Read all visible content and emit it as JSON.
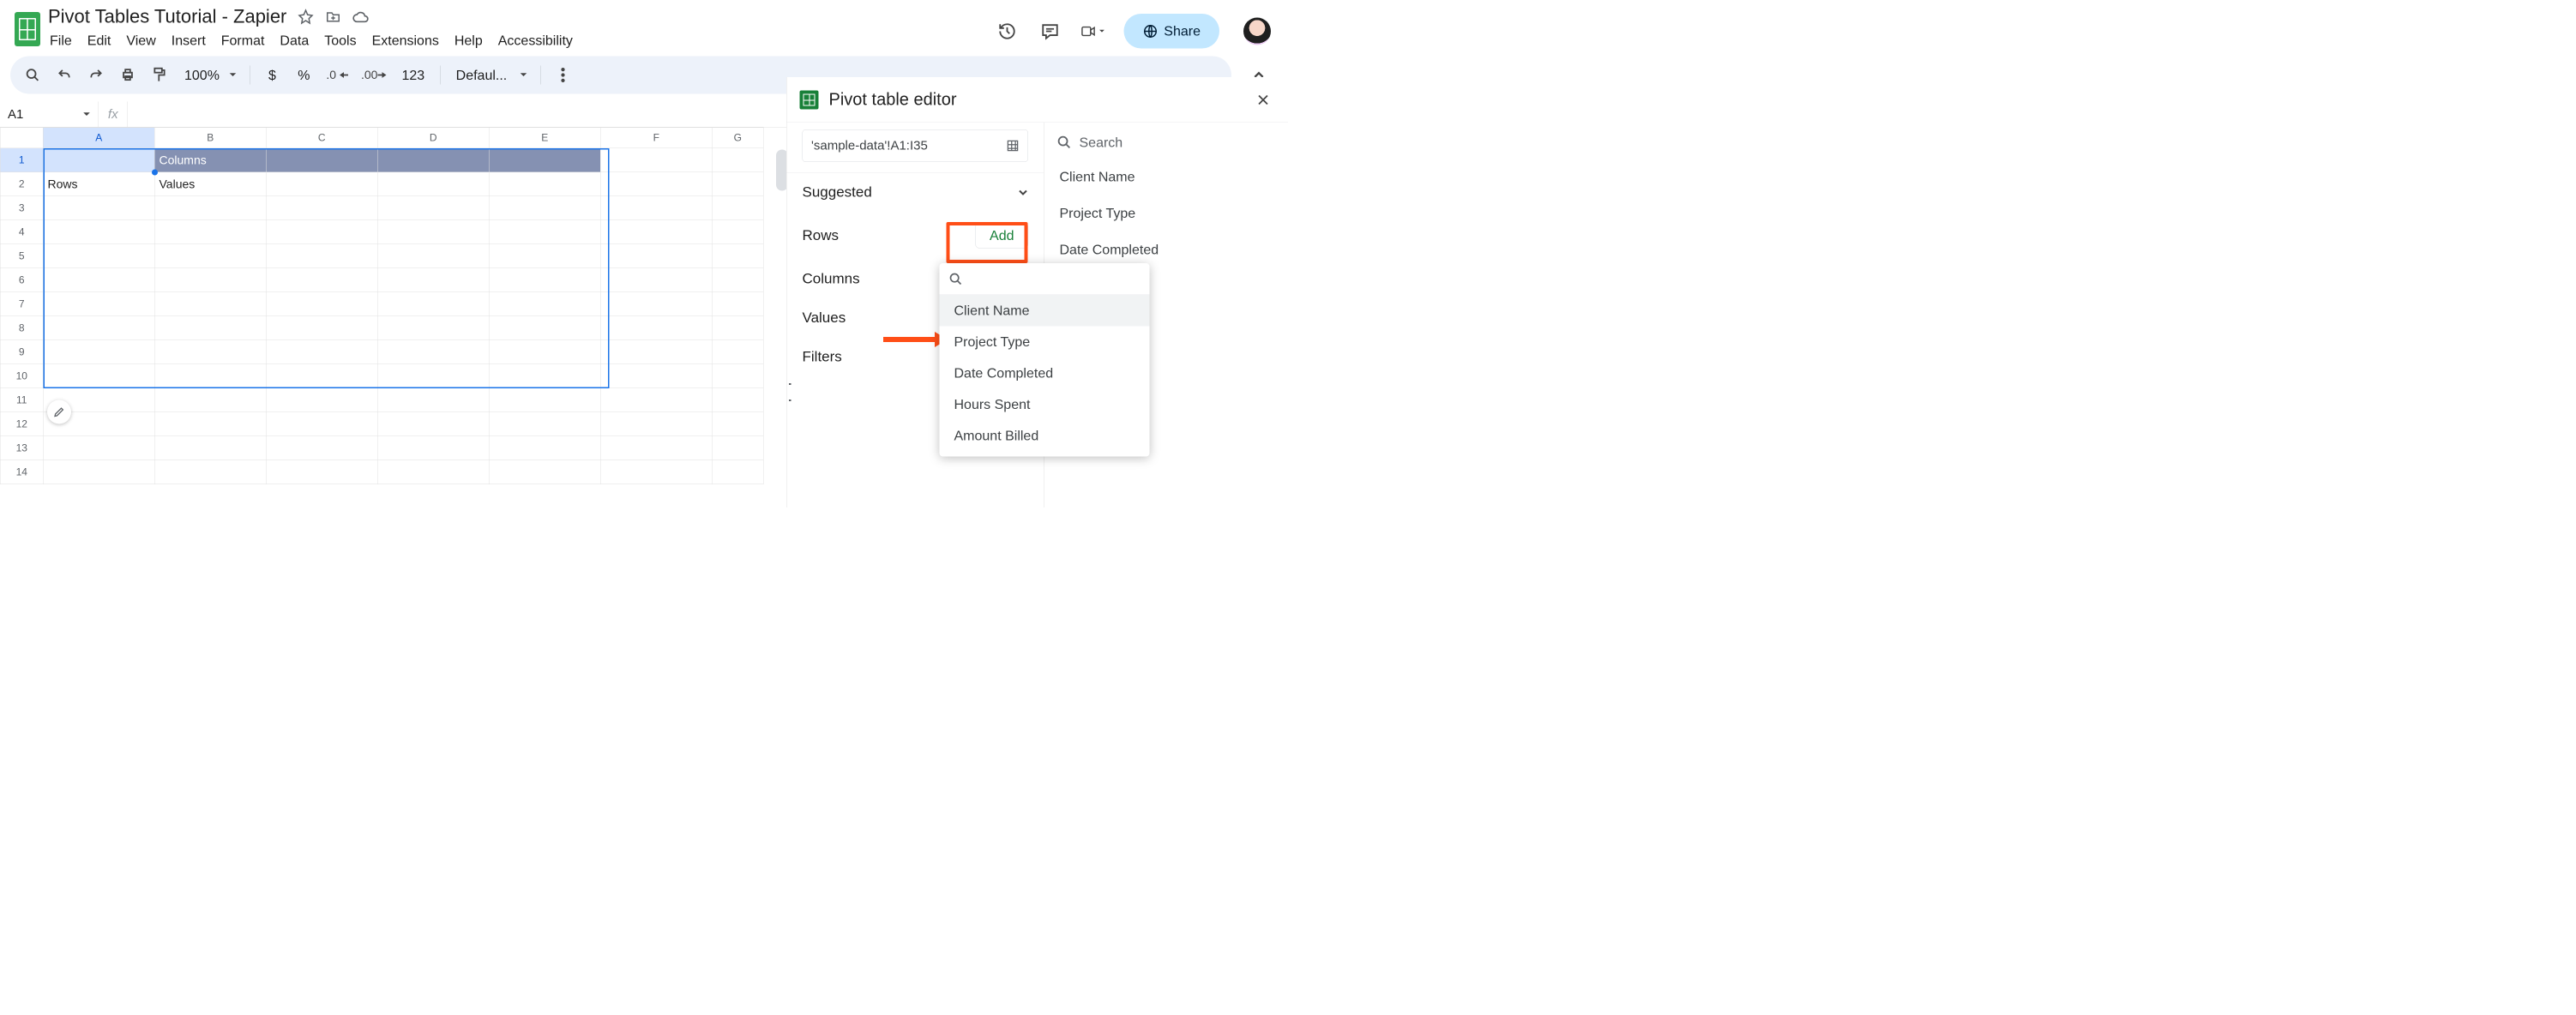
{
  "doc": {
    "title": "Pivot Tables Tutorial - Zapier"
  },
  "menus": {
    "file": "File",
    "edit": "Edit",
    "view": "View",
    "insert": "Insert",
    "format": "Format",
    "data": "Data",
    "tools": "Tools",
    "extensions": "Extensions",
    "help": "Help",
    "accessibility": "Accessibility"
  },
  "toolbar": {
    "zoom": "100%",
    "currency": "$",
    "percent": "%",
    "dec_dec": ".0",
    "dec_inc": ".00",
    "numfmt": "123",
    "font": "Defaul..."
  },
  "share_label": "Share",
  "namebox": "A1",
  "grid": {
    "columns": [
      "A",
      "B",
      "C",
      "D",
      "E",
      "F",
      "G"
    ],
    "rows": [
      1,
      2,
      3,
      4,
      5,
      6,
      7,
      8,
      9,
      10,
      11,
      12,
      13,
      14
    ],
    "cells": {
      "B1": "Columns",
      "A2": "Rows",
      "B2": "Values"
    }
  },
  "pivot": {
    "title": "Pivot table editor",
    "range": "'sample-data'!A1:I35",
    "suggested": "Suggested",
    "sections": {
      "rows": "Rows",
      "columns": "Columns",
      "values": "Values",
      "filters": "Filters"
    },
    "add_label": "Add",
    "search_placeholder": "Search",
    "fields": [
      "Client Name",
      "Project Type",
      "Date Completed"
    ],
    "dropdown_items": [
      "Client Name",
      "Project Type",
      "Date Completed",
      "Hours Spent",
      "Amount Billed"
    ]
  }
}
